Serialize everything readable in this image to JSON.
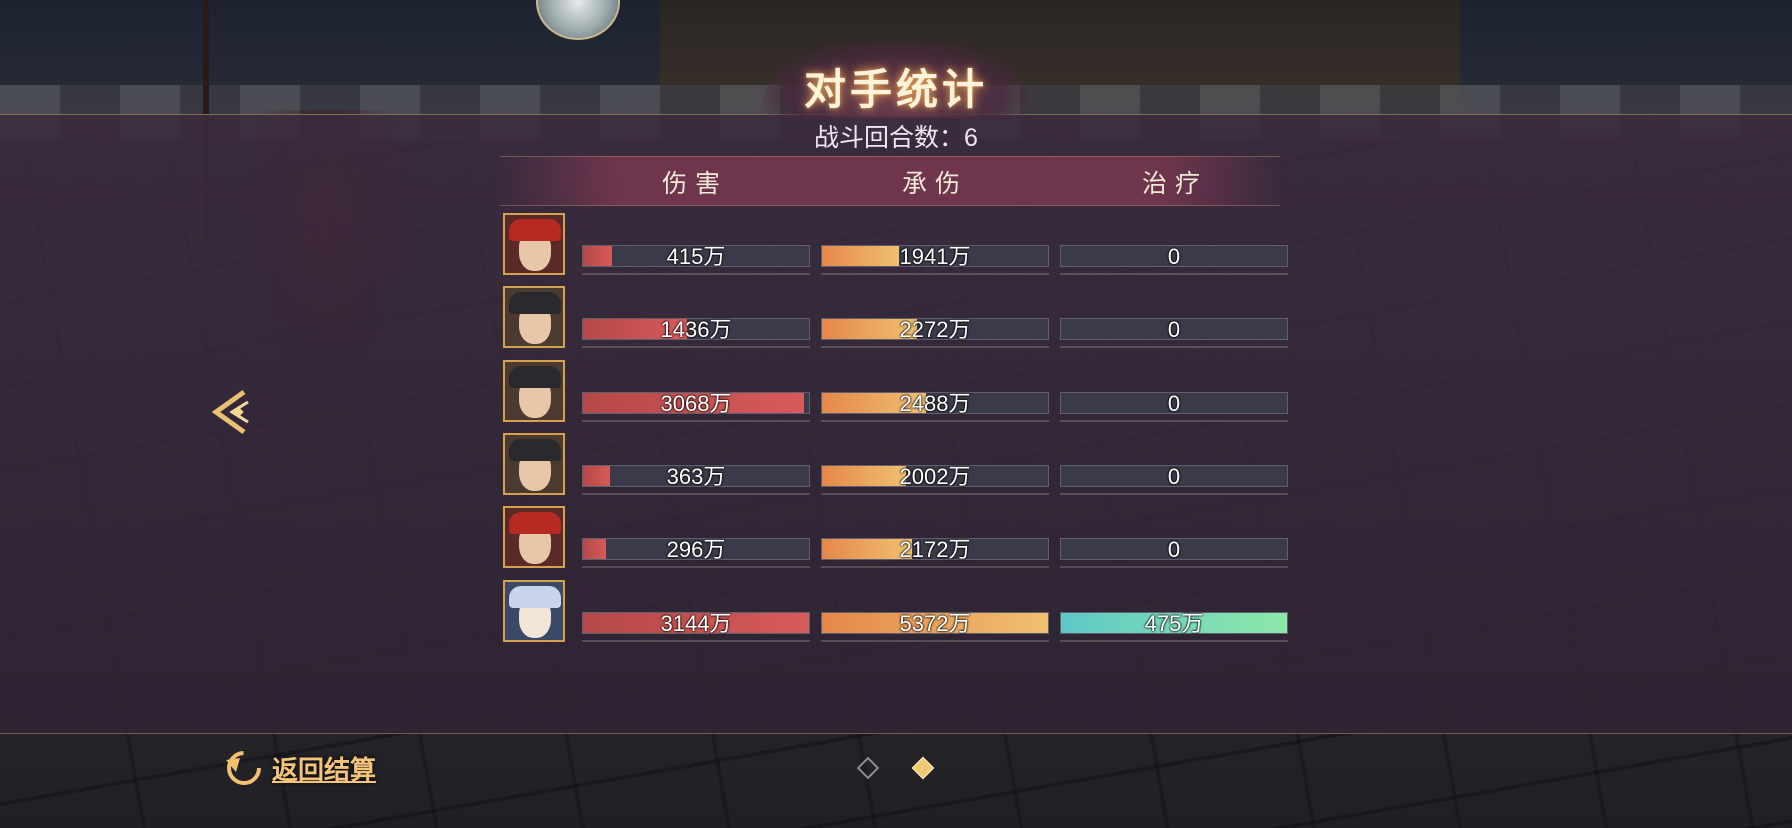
{
  "title": "对手统计",
  "rounds_label": "战斗回合数：",
  "rounds_value": "6",
  "columns": {
    "damage": "伤害",
    "taken": "承伤",
    "heal": "治疗"
  },
  "rows": [
    {
      "portrait": "red-headband-warrior",
      "damage": "415万",
      "damage_fill": 0.13,
      "taken": "1941万",
      "taken_fill": 0.34,
      "heal": "0",
      "heal_fill": 0
    },
    {
      "portrait": "black-helmet-soldier",
      "damage": "1436万",
      "damage_fill": 0.46,
      "taken": "2272万",
      "taken_fill": 0.42,
      "heal": "0",
      "heal_fill": 0
    },
    {
      "portrait": "black-helmet-soldier",
      "damage": "3068万",
      "damage_fill": 0.98,
      "taken": "2488万",
      "taken_fill": 0.46,
      "heal": "0",
      "heal_fill": 0
    },
    {
      "portrait": "black-helmet-soldier",
      "damage": "363万",
      "damage_fill": 0.12,
      "taken": "2002万",
      "taken_fill": 0.37,
      "heal": "0",
      "heal_fill": 0
    },
    {
      "portrait": "red-headband-warrior",
      "damage": "296万",
      "damage_fill": 0.1,
      "taken": "2172万",
      "taken_fill": 0.4,
      "heal": "0",
      "heal_fill": 0
    },
    {
      "portrait": "white-haired-hero",
      "damage": "3144万",
      "damage_fill": 1.0,
      "taken": "5372万",
      "taken_fill": 1.0,
      "heal": "475万",
      "heal_fill": 1.0
    }
  ],
  "footer": {
    "return_label": "返回结算",
    "page_count": 2,
    "active_page": 2
  },
  "icons": {
    "back_arrow": "chevron-left-icon",
    "return": "return-arrow-icon"
  },
  "colors": {
    "damage_bar": "#d85a5a",
    "taken_bar": "#f0a860",
    "heal_bar": "#7ed8b8",
    "accent_gold": "#f4c47a"
  }
}
